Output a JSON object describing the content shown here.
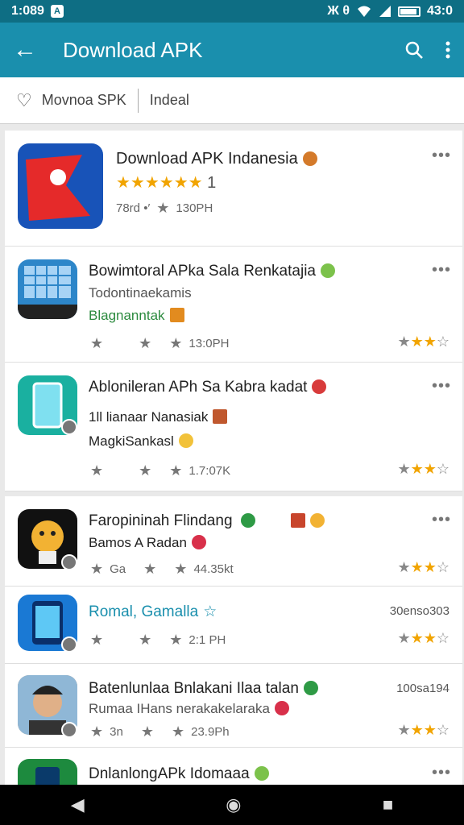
{
  "status": {
    "time": "1:089",
    "badge": "A",
    "indicators": "Ж θ",
    "clock_right": "43:0"
  },
  "appbar": {
    "back_icon": "arrow-left-icon",
    "title": "Download APK",
    "search_icon": "search-icon",
    "menu_icon": "more-vert-icon"
  },
  "filter": {
    "chip1": "Movnoa SPK",
    "chip2": "Indeal"
  },
  "apps": [
    {
      "title": "Download APK Indanesia",
      "stars_text": "★★★★★★",
      "stars_count": "1",
      "meta1": "78rd •′",
      "meta2": "130PH"
    },
    {
      "title": "Bowimtoral APka Sala Renkatajia",
      "line1": "Todontinaekamis",
      "line2": "Blagnanntak",
      "meta": "13:0PH",
      "rating": 2.5
    },
    {
      "title": "Ablonileran APh Sa Kabra kadat",
      "line1": "1ll lianaar Nanasiak",
      "line2": "MagkiSankasl",
      "meta": "1.7:07K",
      "rating": 2.5
    },
    {
      "title": "Faropininah Flindang",
      "line1": "Bamos A Radan",
      "meta_a": "Ga",
      "meta": "44.35kt",
      "rating": 2.5
    },
    {
      "title": "Romal, Gamalla",
      "side": "30enso303",
      "meta": "2:1 PH",
      "rating": 2.5
    },
    {
      "title": "Batenlunlaa Bnlakani Ilaa talan",
      "line1": "Rumaa IHans nerakakelaraka",
      "meta_a": "3n",
      "meta": "23.9Ph",
      "side": "100sa194",
      "rating": 2.5
    },
    {
      "title": "DnlanlongAPk Idomaaa"
    }
  ],
  "nav": {
    "back": "◀",
    "home": "◉",
    "recent": "■"
  },
  "colors": {
    "statusbar": "#0e6e84",
    "appbar": "#1a8fad",
    "star": "#f1a400",
    "accent_blue": "#1a8fad",
    "accent_green": "#2b8a3e"
  }
}
